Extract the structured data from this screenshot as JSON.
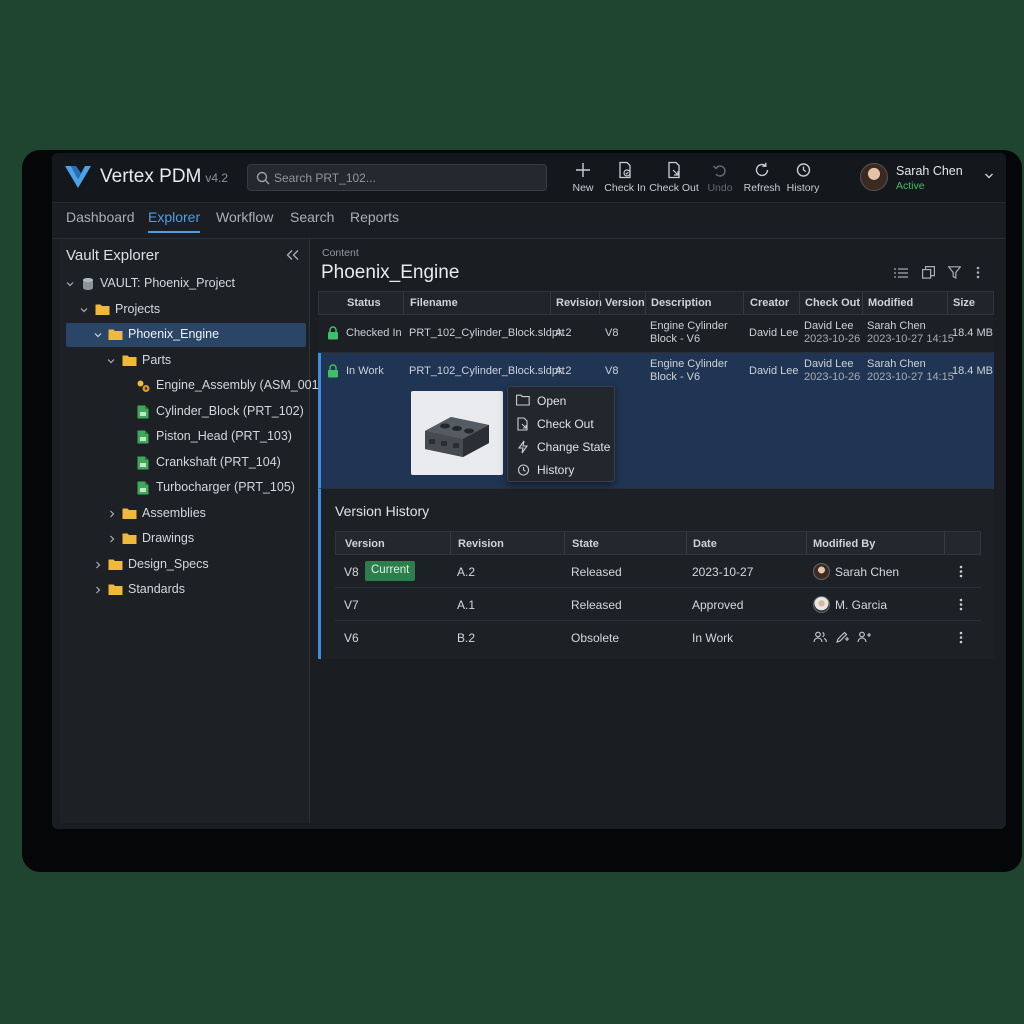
{
  "app": {
    "name": "Vertex PDM",
    "version": "v4.2",
    "search_placeholder": "Search PRT_102...",
    "accent_color": "#4c9ee8",
    "logo_icon": "vertex-v-logo"
  },
  "toolbar": {
    "new_label": "New",
    "checkin_label": "Check In",
    "checkout_label": "Check Out",
    "undo_label": "Undo",
    "refresh_label": "Refresh",
    "history_label": "History"
  },
  "user": {
    "name": "Sarah Chen",
    "status": "Active",
    "status_color": "#3fbf6a"
  },
  "nav": {
    "tabs": [
      "Dashboard",
      "Explorer",
      "Workflow",
      "Search",
      "Reports"
    ],
    "active": "Explorer"
  },
  "sidebar": {
    "title": "Vault Explorer",
    "tree": [
      {
        "label": "VAULT: Phoenix_Project",
        "icon": "database-icon",
        "expanded": true
      },
      {
        "label": "Projects",
        "icon": "folder-icon",
        "expanded": true
      },
      {
        "label": "Phoenix_Engine",
        "icon": "folder-icon",
        "expanded": true,
        "selected": true
      },
      {
        "label": "Parts",
        "icon": "folder-icon",
        "expanded": true
      },
      {
        "label": "Engine_Assembly (ASM_001)",
        "icon": "assembly-icon"
      },
      {
        "label": "Cylinder_Block (PRT_102)",
        "icon": "part-file-icon"
      },
      {
        "label": "Piston_Head (PRT_103)",
        "icon": "part-file-icon"
      },
      {
        "label": "Crankshaft (PRT_104)",
        "icon": "part-file-icon"
      },
      {
        "label": "Turbocharger (PRT_105)",
        "icon": "part-file-icon"
      },
      {
        "label": "Assemblies",
        "icon": "folder-icon",
        "expanded": false
      },
      {
        "label": "Drawings",
        "icon": "folder-icon",
        "expanded": false
      },
      {
        "label": "Design_Specs",
        "icon": "folder-icon",
        "expanded": false
      },
      {
        "label": "Standards",
        "icon": "folder-icon",
        "expanded": false
      }
    ]
  },
  "content": {
    "breadcrumb": "Content",
    "title": "Phoenix_Engine",
    "columns": [
      "Status",
      "Filename",
      "Revision",
      "Version",
      "Description",
      "Creator",
      "Check Out",
      "Modified",
      "Size"
    ],
    "rows": [
      {
        "status": "Checked In",
        "filename": "PRT_102_Cylinder_Block.sldprt",
        "revision": "A.2",
        "version": "V8",
        "description_1": "Engine Cylinder",
        "description_2": "Block - V6",
        "creator": "David Lee",
        "checkout_user": "David Lee",
        "checkout_date": "2023-10-26",
        "modified_user": "Sarah Chen",
        "modified_date": "2023-10-27 14:15",
        "size": "18.4 MB"
      },
      {
        "status": "In Work",
        "filename": "PRT_102_Cylinder_Block.sldprt",
        "revision": "A.2",
        "version": "V8",
        "description_1": "Engine Cylinder",
        "description_2": "Block - V6",
        "creator": "David Lee",
        "checkout_user": "David Lee",
        "checkout_date": "2023-10-26",
        "modified_user": "Sarah Chen",
        "modified_date": "2023-10-27 14:15",
        "size": "18.4 MB"
      }
    ],
    "context_menu": [
      "Open",
      "Check Out",
      "Change State",
      "History"
    ]
  },
  "version_history": {
    "title": "Version History",
    "columns": [
      "Version",
      "Revision",
      "State",
      "Date",
      "Modified By"
    ],
    "rows": [
      {
        "version": "V8",
        "badge": "Current",
        "revision": "A.2",
        "state": "Released",
        "date": "2023-10-27",
        "modified_by": "Sarah Chen"
      },
      {
        "version": "V7",
        "revision": "A.1",
        "state": "Released",
        "date": "Approved",
        "modified_by": "M. Garcia"
      },
      {
        "version": "V6",
        "revision": "B.2",
        "state": "Obsolete",
        "date": "In Work",
        "modified_by": ""
      }
    ]
  }
}
